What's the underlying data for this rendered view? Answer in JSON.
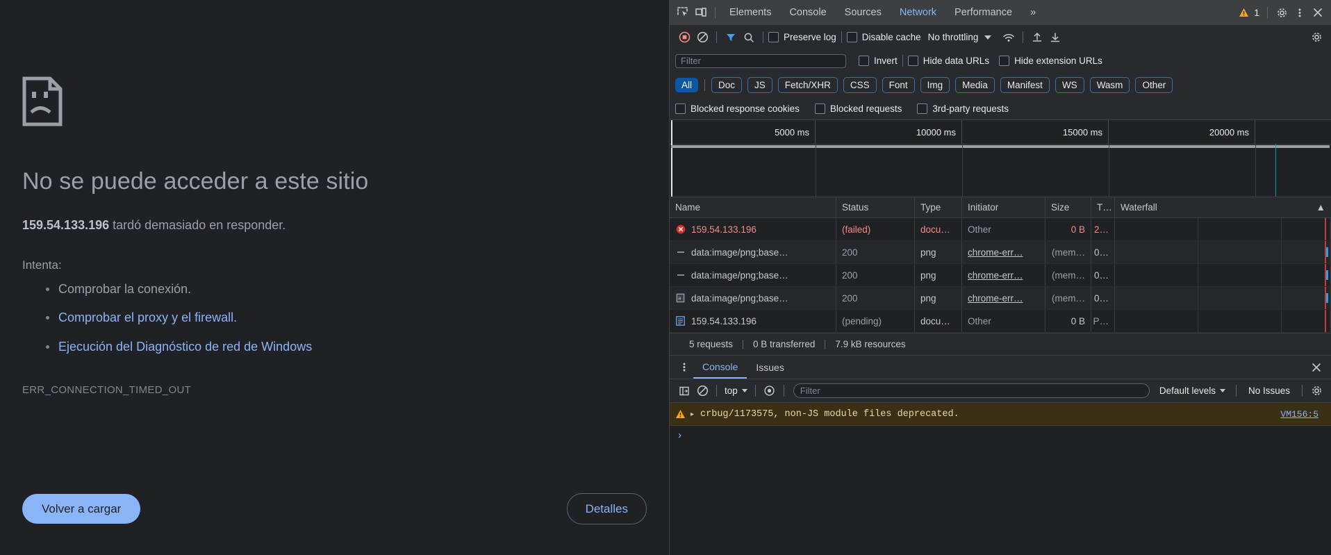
{
  "error_page": {
    "icon": "sad-page-icon",
    "title": "No se puede acceder a este sitio",
    "subtext_host": "159.54.133.196",
    "subtext_rest": " tardó demasiado en responder.",
    "try_label": "Intenta:",
    "suggestions": [
      {
        "text": "Comprobar la conexión.",
        "is_link": false
      },
      {
        "text": "Comprobar el proxy y el firewall.",
        "is_link": true
      },
      {
        "text": "Ejecución del Diagnóstico de red de Windows",
        "is_link": true
      }
    ],
    "error_code": "ERR_CONNECTION_TIMED_OUT",
    "reload_button": "Volver a cargar",
    "details_button": "Detalles",
    "link_color": "#8ab4f8",
    "reload_bg": "#8ab4f8"
  },
  "devtools": {
    "tabs": [
      {
        "label": "Elements",
        "active": false
      },
      {
        "label": "Console",
        "active": false
      },
      {
        "label": "Sources",
        "active": false
      },
      {
        "label": "Network",
        "active": true
      },
      {
        "label": "Performance",
        "active": false
      }
    ],
    "more_tabs": "»",
    "warning_count": "1",
    "icons": {
      "inspect": "inspect-element-icon",
      "device": "device-toolbar-icon",
      "warning": "warning-triangle-icon",
      "settings": "gear-icon",
      "more": "more-vertical-icon",
      "close": "close-icon"
    },
    "network_toolbar": {
      "record": "record-stop-icon",
      "clear": "clear-icon",
      "filter": "filter-funnel-icon",
      "search": "search-icon",
      "preserve_log": "Preserve log",
      "disable_cache": "Disable cache",
      "throttling": "No throttling",
      "wifi": "network-conditions-icon",
      "import": "import-har-icon",
      "export": "export-har-icon",
      "settings": "gear-icon"
    },
    "filter_row": {
      "placeholder": "Filter",
      "value": "",
      "invert": "Invert",
      "hide_data_urls": "Hide data URLs",
      "hide_extension_urls": "Hide extension URLs"
    },
    "type_chips": [
      {
        "label": "All",
        "active": true
      },
      {
        "label": "Doc",
        "active": false
      },
      {
        "label": "JS",
        "active": false
      },
      {
        "label": "Fetch/XHR",
        "active": false
      },
      {
        "label": "CSS",
        "active": false
      },
      {
        "label": "Font",
        "active": false
      },
      {
        "label": "Img",
        "active": false
      },
      {
        "label": "Media",
        "active": false
      },
      {
        "label": "Manifest",
        "active": false
      },
      {
        "label": "WS",
        "active": false
      },
      {
        "label": "Wasm",
        "active": false
      },
      {
        "label": "Other",
        "active": false
      }
    ],
    "blocked_row": [
      "Blocked response cookies",
      "Blocked requests",
      "3rd-party requests"
    ],
    "overview_ticks": [
      "5000 ms",
      "10000 ms",
      "15000 ms",
      "20000 ms"
    ],
    "table": {
      "columns": [
        "Name",
        "Status",
        "Type",
        "Initiator",
        "Size",
        "T…",
        "Waterfall"
      ],
      "sort_indicator": "▲",
      "rows": [
        {
          "icon": "error-circle-icon",
          "name": "159.54.133.196",
          "status": "(failed)",
          "type": "docu…",
          "initiator": "Other",
          "initiator_link": false,
          "size": "0 B",
          "time": "2…",
          "failed": true
        },
        {
          "icon": "dash-icon",
          "name": "data:image/png;base…",
          "status": "200",
          "type": "png",
          "initiator": "chrome-err…",
          "initiator_link": true,
          "size": "(mem…",
          "time": "0…",
          "failed": false
        },
        {
          "icon": "dash-icon",
          "name": "data:image/png;base…",
          "status": "200",
          "type": "png",
          "initiator": "chrome-err…",
          "initiator_link": true,
          "size": "(mem…",
          "time": "0…",
          "failed": false
        },
        {
          "icon": "image-file-icon",
          "name": "data:image/png;base…",
          "status": "200",
          "type": "png",
          "initiator": "chrome-err…",
          "initiator_link": true,
          "size": "(mem…",
          "time": "0…",
          "failed": false
        },
        {
          "icon": "document-icon",
          "name": "159.54.133.196",
          "status": "(pending)",
          "type": "docu…",
          "initiator": "Other",
          "initiator_link": false,
          "size": "0 B",
          "time": "P…",
          "failed": false
        }
      ]
    },
    "summary": [
      "5 requests",
      "0 B transferred",
      "7.9 kB resources"
    ],
    "drawer": {
      "tabs": [
        {
          "label": "Console",
          "active": true
        },
        {
          "label": "Issues",
          "active": false
        }
      ],
      "more_icon": "more-vertical-icon",
      "close_icon": "close-icon",
      "console_toolbar": {
        "sidebar": "console-sidebar-icon",
        "clear": "clear-console-icon",
        "context": "top",
        "eye": "live-expression-icon",
        "filter_placeholder": "Filter",
        "filter_value": "",
        "levels": "Default levels",
        "issues": "No Issues",
        "settings": "gear-icon"
      },
      "messages": [
        {
          "level": "warning",
          "icon": "warning-triangle-icon",
          "text": "crbug/1173575, non-JS module files deprecated.",
          "source": "VM156:5"
        }
      ],
      "prompt": "›"
    }
  },
  "colors": {
    "accent_blue": "#8ab4f8",
    "active_chip": "#0b57a4",
    "error_red": "#f28b82",
    "warning_orange": "#f5a623",
    "waterfall_bar": "#29a3f0",
    "dcl_marker": "#c63a3a",
    "overview_marker": "#00a0a0"
  }
}
